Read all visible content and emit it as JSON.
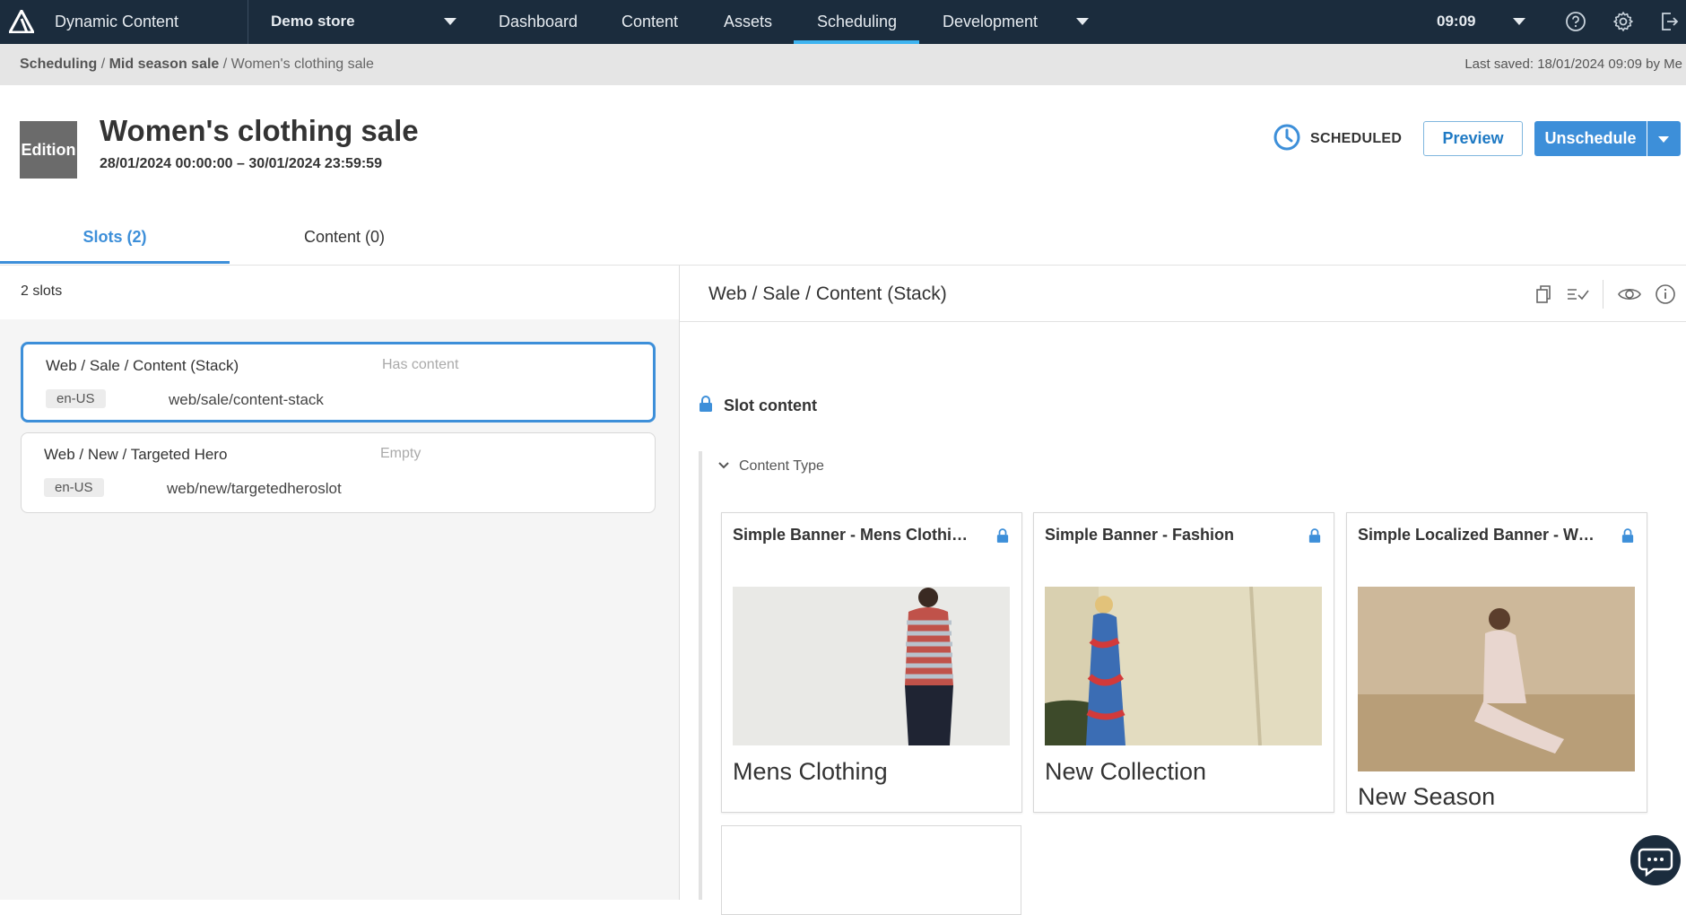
{
  "topbar": {
    "app_title": "Dynamic Content",
    "hub": "Demo store",
    "nav": [
      "Dashboard",
      "Content",
      "Assets",
      "Scheduling",
      "Development"
    ],
    "active_nav": "Scheduling",
    "time": "09:09",
    "icons": [
      "help-icon",
      "settings-icon",
      "sign-out-icon"
    ]
  },
  "breadcrumb": {
    "items": [
      "Scheduling",
      "Mid season sale",
      "Women's clothing sale"
    ],
    "sep": "/",
    "last_saved": "Last saved: 18/01/2024 09:09 by Me"
  },
  "edition": {
    "badge": "Edition",
    "title": "Women's clothing sale",
    "start": "28/01/2024 00:00:00",
    "dash": "–",
    "end": "30/01/2024 23:59:59",
    "status": "SCHEDULED",
    "preview_label": "Preview",
    "unschedule_label": "Unschedule"
  },
  "tabs": [
    {
      "label": "Slots (2)",
      "active": true
    },
    {
      "label": "Content (0)",
      "active": false
    }
  ],
  "slots": {
    "count_label": "2 slots",
    "items": [
      {
        "name": "Web / Sale / Content (Stack)",
        "state": "Has content",
        "locale": "en-US",
        "key": "web/sale/content-stack",
        "selected": true
      },
      {
        "name": "Web / New / Targeted Hero",
        "state": "Empty",
        "locale": "en-US",
        "key": "web/new/targetedheroslot",
        "selected": false
      }
    ]
  },
  "detail": {
    "path": "Web / Sale / Content (Stack)",
    "slot_content_label": "Slot content",
    "content_type_label": "Content Type",
    "cards": [
      {
        "title": "Simple Banner - Mens Clothing ...",
        "caption": "Mens Clothing"
      },
      {
        "title": "Simple Banner - Fashion",
        "caption": "New Collection"
      },
      {
        "title": "Simple Localized Banner - Wo...",
        "caption": "New Season"
      }
    ]
  },
  "colors": {
    "nav_bg": "#1b2c3d",
    "accent": "#3d8fd9",
    "active_underline": "#3fb4f0"
  }
}
